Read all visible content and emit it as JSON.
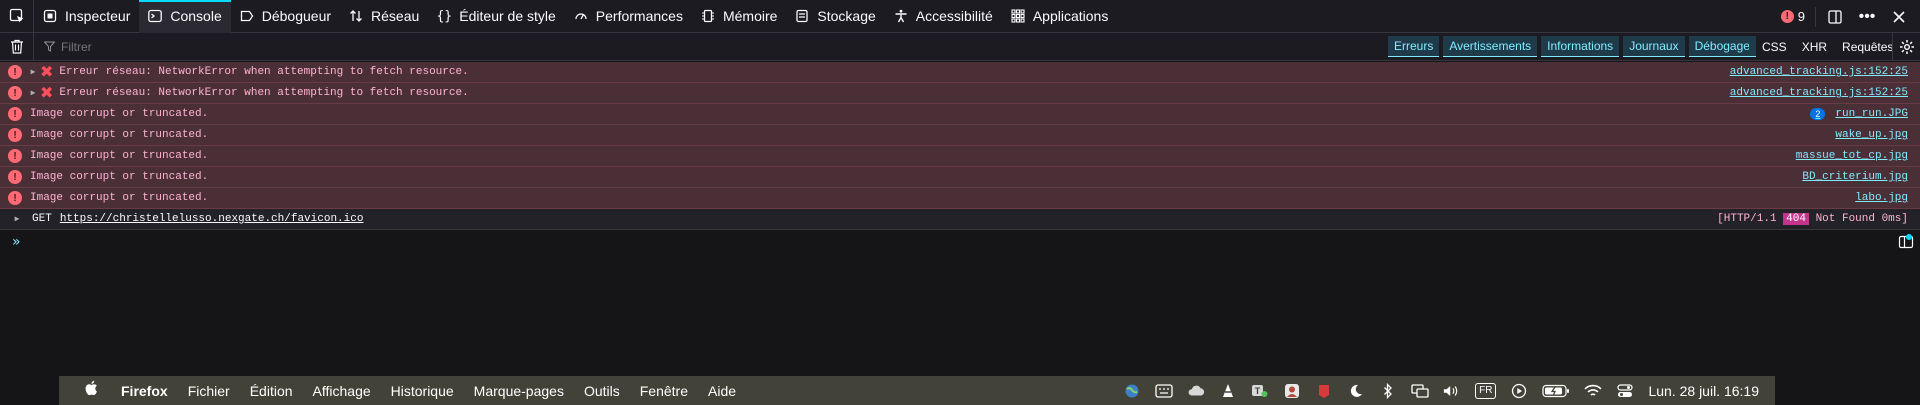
{
  "tabs": [
    {
      "label": "Inspecteur",
      "icon": "inspector-icon"
    },
    {
      "label": "Console",
      "icon": "console-icon",
      "selected": true
    },
    {
      "label": "Débogueur",
      "icon": "debugger-icon"
    },
    {
      "label": "Réseau",
      "icon": "network-icon"
    },
    {
      "label": "Éditeur de style",
      "icon": "style-editor-icon"
    },
    {
      "label": "Performances",
      "icon": "performance-icon"
    },
    {
      "label": "Mémoire",
      "icon": "memory-icon"
    },
    {
      "label": "Stockage",
      "icon": "storage-icon"
    },
    {
      "label": "Accessibilité",
      "icon": "accessibility-icon"
    },
    {
      "label": "Applications",
      "icon": "applications-icon"
    }
  ],
  "error_count": "9",
  "filter": {
    "placeholder": "Filtrer"
  },
  "levels": [
    "Erreurs",
    "Avertissements",
    "Informations",
    "Journaux",
    "Débogage"
  ],
  "requests": [
    "CSS",
    "XHR",
    "Requêtes"
  ],
  "messages": [
    {
      "text": "Erreur réseau: NetworkError when attempting to fetch resource.",
      "location": "advanced_tracking.js:152:25"
    },
    {
      "text": "Erreur réseau: NetworkError when attempting to fetch resource.",
      "location": "advanced_tracking.js:152:25"
    },
    {
      "text": "Image corrupt or truncated.",
      "location": "run_run.JPG",
      "badge": "2"
    },
    {
      "text": "Image corrupt or truncated.",
      "location": "wake_up.jpg"
    },
    {
      "text": "Image corrupt or truncated.",
      "location": "massue_tot_cp.jpg"
    },
    {
      "text": "Image corrupt or truncated.",
      "location": "BD_criterium.jpg"
    },
    {
      "text": "Image corrupt or truncated.",
      "location": "labo.jpg"
    }
  ],
  "network_request": {
    "method": "GET",
    "url": "https://christellelusso.nexgate.ch/favicon.ico",
    "status_prefix": "[HTTP/1.1 ",
    "status_code": "404",
    "status_suffix": " Not Found 0ms]"
  },
  "prompt": "»",
  "menubar": {
    "app_name": "Firefox",
    "items": [
      "Fichier",
      "Édition",
      "Affichage",
      "Historique",
      "Marque-pages",
      "Outils",
      "Fenêtre",
      "Aide"
    ],
    "input_source": "FR",
    "clock": "Lun. 28 juil.  16:19"
  },
  "colors": {
    "error_row": "#4b2f36",
    "error_text": "#ffb3d2",
    "link": "#80ebff",
    "accent": "#00ddff"
  }
}
